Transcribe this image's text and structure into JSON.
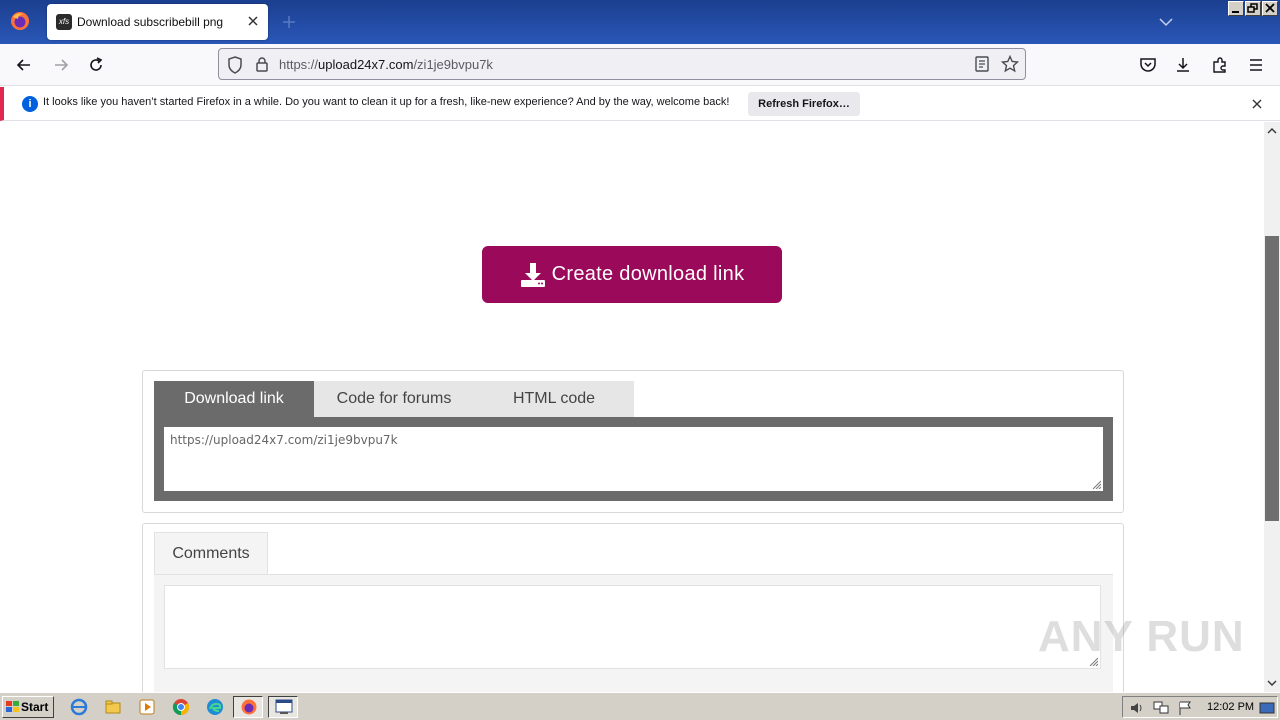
{
  "browser": {
    "tab_title": "Download subscribebill png",
    "favicon_text": "xfs",
    "url_prefix": "https://",
    "url_domain": "upload24x7.com",
    "url_path": "/zi1je9bvpu7k"
  },
  "notification": {
    "message": "It looks like you haven’t started Firefox in a while. Do you want to clean it up for a fresh, like-new experience? And by the way, welcome back!",
    "button_label": "Refresh Firefox…"
  },
  "page": {
    "create_button_label": "Create download link",
    "tabs": [
      "Download link",
      "Code for forums",
      "HTML code"
    ],
    "active_tab": "Download link",
    "link_value": "https://upload24x7.com/zi1je9bvpu7k",
    "comments_tab": "Comments",
    "brand_color": "#9b0a5a"
  },
  "watermark": "ANY RUN",
  "taskbar": {
    "start_label": "Start",
    "clock": "12:02 PM"
  }
}
